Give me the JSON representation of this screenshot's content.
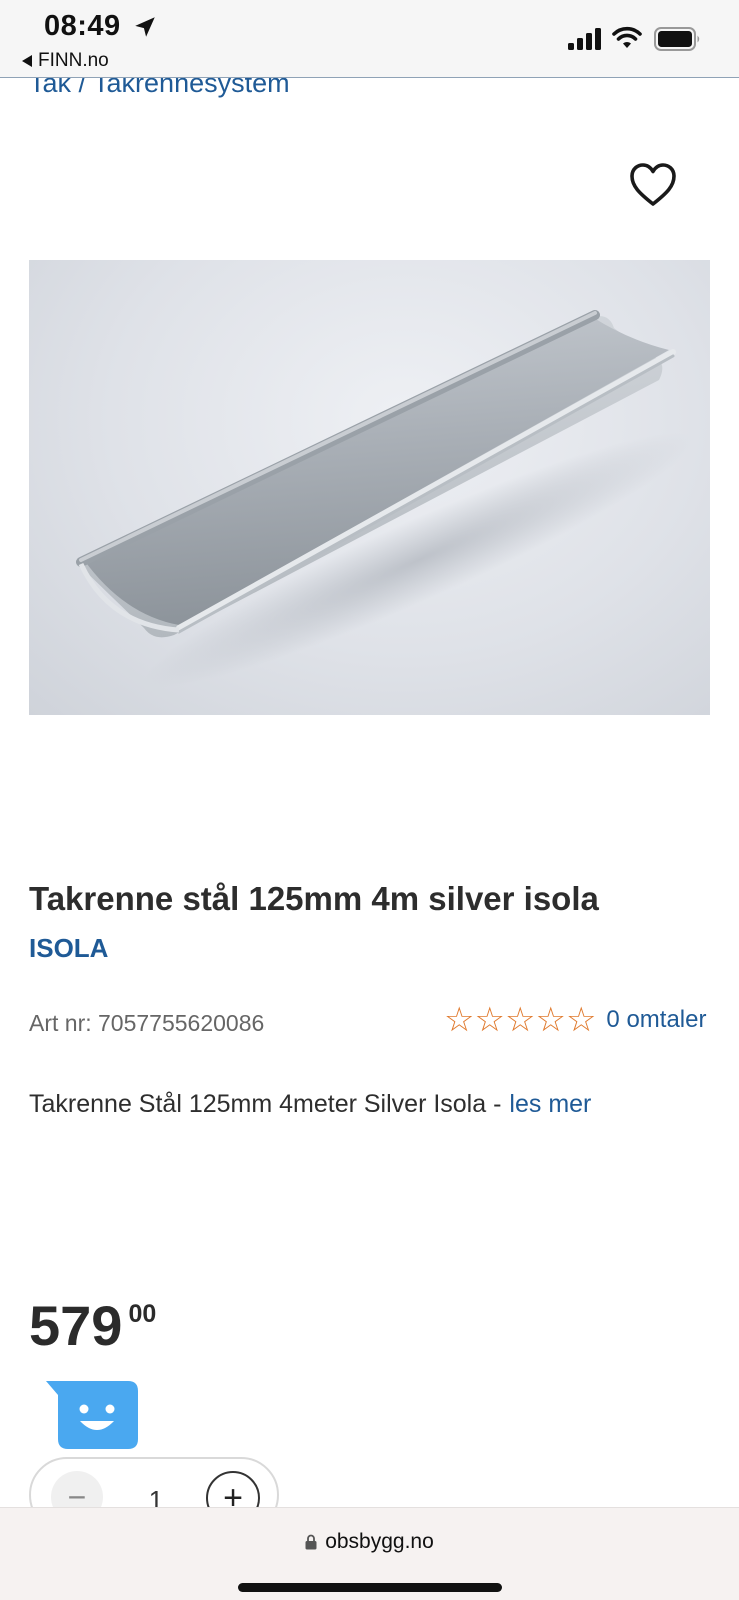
{
  "status_bar": {
    "time": "08:49",
    "back_app": "FINN.no"
  },
  "breadcrumb": "Tak / Takrennesystem",
  "product": {
    "title": "Takrenne stål 125mm 4m silver isola",
    "brand": "ISOLA",
    "art_nr": "Art nr: 7057755620086",
    "rating_stars": 0,
    "star_glyph": "☆",
    "reviews": "0 omtaler",
    "description": "Takrenne Stål 125mm 4meter Silver Isola -",
    "read_more": "les mer",
    "price_int": "579",
    "price_dec": "00"
  },
  "quantity": {
    "minus": "−",
    "value": "1",
    "plus": "+"
  },
  "browser": {
    "url": "obsbygg.no"
  },
  "colors": {
    "link": "#1f5a96",
    "star": "#e07a2e",
    "chat": "#4aa8f0"
  }
}
